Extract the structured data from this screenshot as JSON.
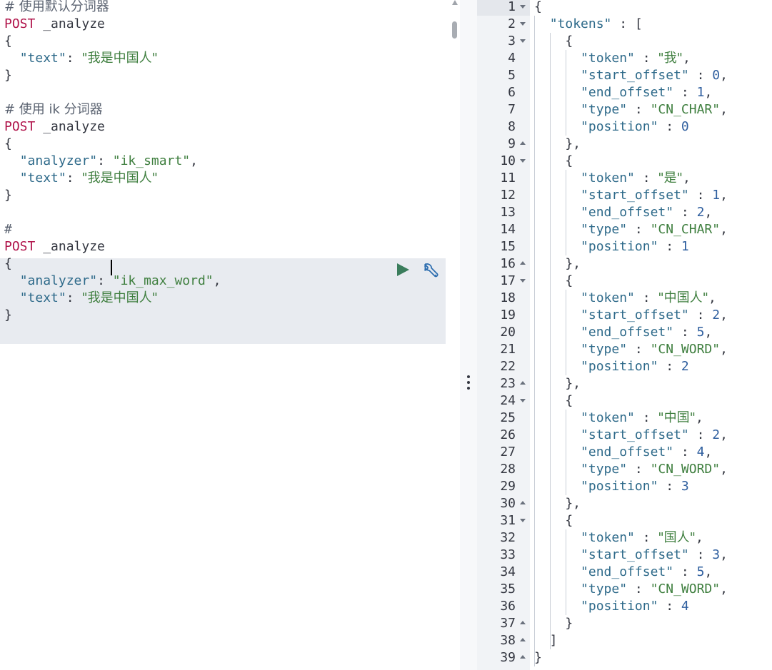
{
  "request_editor": {
    "lines": [
      [
        {
          "t": "comment",
          "v": "# 使用默认分词器"
        }
      ],
      [
        {
          "t": "method",
          "v": "POST"
        },
        {
          "t": "url",
          "v": " _analyze"
        }
      ],
      [
        {
          "t": "brace",
          "v": "{"
        }
      ],
      [
        {
          "t": "punct",
          "v": "  "
        },
        {
          "t": "key",
          "v": "\"text\""
        },
        {
          "t": "punct",
          "v": ": "
        },
        {
          "t": "str",
          "v": "\"我是中国人\""
        }
      ],
      [
        {
          "t": "brace",
          "v": "}"
        }
      ],
      [],
      [
        {
          "t": "comment",
          "v": "# 使用 ik 分词器"
        }
      ],
      [
        {
          "t": "method",
          "v": "POST"
        },
        {
          "t": "url",
          "v": " _analyze"
        }
      ],
      [
        {
          "t": "brace",
          "v": "{"
        }
      ],
      [
        {
          "t": "punct",
          "v": "  "
        },
        {
          "t": "key",
          "v": "\"analyzer\""
        },
        {
          "t": "punct",
          "v": ": "
        },
        {
          "t": "str",
          "v": "\"ik_smart\""
        },
        {
          "t": "punct",
          "v": ","
        }
      ],
      [
        {
          "t": "punct",
          "v": "  "
        },
        {
          "t": "key",
          "v": "\"text\""
        },
        {
          "t": "punct",
          "v": ": "
        },
        {
          "t": "str",
          "v": "\"我是中国人\""
        }
      ],
      [
        {
          "t": "brace",
          "v": "}"
        }
      ],
      [],
      [
        {
          "t": "comment",
          "v": "#"
        }
      ],
      [
        {
          "t": "method",
          "v": "POST"
        },
        {
          "t": "url",
          "v": " _analyze"
        }
      ],
      [
        {
          "t": "brace",
          "v": "{"
        }
      ],
      [
        {
          "t": "punct",
          "v": "  "
        },
        {
          "t": "key",
          "v": "\"analyzer\""
        },
        {
          "t": "punct",
          "v": ": "
        },
        {
          "t": "str",
          "v": "\"ik_max_word\""
        },
        {
          "t": "punct",
          "v": ","
        }
      ],
      [
        {
          "t": "punct",
          "v": "  "
        },
        {
          "t": "key",
          "v": "\"text\""
        },
        {
          "t": "punct",
          "v": ": "
        },
        {
          "t": "str",
          "v": "\"我是中国人\""
        }
      ],
      [
        {
          "t": "brace",
          "v": "}"
        }
      ]
    ],
    "run_icon": "play-icon",
    "settings_icon": "wrench-icon"
  },
  "response_viewer": {
    "lines": [
      {
        "n": "1",
        "fold": "open",
        "p": [
          {
            "t": "brace",
            "v": "{"
          }
        ]
      },
      {
        "n": "2",
        "fold": "open",
        "p": [
          {
            "t": "punct",
            "v": "  "
          },
          {
            "t": "key",
            "v": "\"tokens\""
          },
          {
            "t": "punct",
            "v": " : ["
          }
        ]
      },
      {
        "n": "3",
        "fold": "open",
        "p": [
          {
            "t": "punct",
            "v": "    {"
          }
        ]
      },
      {
        "n": "4",
        "p": [
          {
            "t": "punct",
            "v": "      "
          },
          {
            "t": "key",
            "v": "\"token\""
          },
          {
            "t": "punct",
            "v": " : "
          },
          {
            "t": "str",
            "v": "\"我\""
          },
          {
            "t": "punct",
            "v": ","
          }
        ]
      },
      {
        "n": "5",
        "p": [
          {
            "t": "punct",
            "v": "      "
          },
          {
            "t": "key",
            "v": "\"start_offset\""
          },
          {
            "t": "punct",
            "v": " : "
          },
          {
            "t": "num",
            "v": "0"
          },
          {
            "t": "punct",
            "v": ","
          }
        ]
      },
      {
        "n": "6",
        "p": [
          {
            "t": "punct",
            "v": "      "
          },
          {
            "t": "key",
            "v": "\"end_offset\""
          },
          {
            "t": "punct",
            "v": " : "
          },
          {
            "t": "num",
            "v": "1"
          },
          {
            "t": "punct",
            "v": ","
          }
        ]
      },
      {
        "n": "7",
        "p": [
          {
            "t": "punct",
            "v": "      "
          },
          {
            "t": "key",
            "v": "\"type\""
          },
          {
            "t": "punct",
            "v": " : "
          },
          {
            "t": "str",
            "v": "\"CN_CHAR\""
          },
          {
            "t": "punct",
            "v": ","
          }
        ]
      },
      {
        "n": "8",
        "p": [
          {
            "t": "punct",
            "v": "      "
          },
          {
            "t": "key",
            "v": "\"position\""
          },
          {
            "t": "punct",
            "v": " : "
          },
          {
            "t": "num",
            "v": "0"
          }
        ]
      },
      {
        "n": "9",
        "fold": "closed",
        "p": [
          {
            "t": "punct",
            "v": "    },"
          }
        ]
      },
      {
        "n": "10",
        "fold": "open",
        "p": [
          {
            "t": "punct",
            "v": "    {"
          }
        ]
      },
      {
        "n": "11",
        "p": [
          {
            "t": "punct",
            "v": "      "
          },
          {
            "t": "key",
            "v": "\"token\""
          },
          {
            "t": "punct",
            "v": " : "
          },
          {
            "t": "str",
            "v": "\"是\""
          },
          {
            "t": "punct",
            "v": ","
          }
        ]
      },
      {
        "n": "12",
        "p": [
          {
            "t": "punct",
            "v": "      "
          },
          {
            "t": "key",
            "v": "\"start_offset\""
          },
          {
            "t": "punct",
            "v": " : "
          },
          {
            "t": "num",
            "v": "1"
          },
          {
            "t": "punct",
            "v": ","
          }
        ]
      },
      {
        "n": "13",
        "p": [
          {
            "t": "punct",
            "v": "      "
          },
          {
            "t": "key",
            "v": "\"end_offset\""
          },
          {
            "t": "punct",
            "v": " : "
          },
          {
            "t": "num",
            "v": "2"
          },
          {
            "t": "punct",
            "v": ","
          }
        ]
      },
      {
        "n": "14",
        "p": [
          {
            "t": "punct",
            "v": "      "
          },
          {
            "t": "key",
            "v": "\"type\""
          },
          {
            "t": "punct",
            "v": " : "
          },
          {
            "t": "str",
            "v": "\"CN_CHAR\""
          },
          {
            "t": "punct",
            "v": ","
          }
        ]
      },
      {
        "n": "15",
        "p": [
          {
            "t": "punct",
            "v": "      "
          },
          {
            "t": "key",
            "v": "\"position\""
          },
          {
            "t": "punct",
            "v": " : "
          },
          {
            "t": "num",
            "v": "1"
          }
        ]
      },
      {
        "n": "16",
        "fold": "closed",
        "p": [
          {
            "t": "punct",
            "v": "    },"
          }
        ]
      },
      {
        "n": "17",
        "fold": "open",
        "p": [
          {
            "t": "punct",
            "v": "    {"
          }
        ]
      },
      {
        "n": "18",
        "p": [
          {
            "t": "punct",
            "v": "      "
          },
          {
            "t": "key",
            "v": "\"token\""
          },
          {
            "t": "punct",
            "v": " : "
          },
          {
            "t": "str",
            "v": "\"中国人\""
          },
          {
            "t": "punct",
            "v": ","
          }
        ]
      },
      {
        "n": "19",
        "p": [
          {
            "t": "punct",
            "v": "      "
          },
          {
            "t": "key",
            "v": "\"start_offset\""
          },
          {
            "t": "punct",
            "v": " : "
          },
          {
            "t": "num",
            "v": "2"
          },
          {
            "t": "punct",
            "v": ","
          }
        ]
      },
      {
        "n": "20",
        "p": [
          {
            "t": "punct",
            "v": "      "
          },
          {
            "t": "key",
            "v": "\"end_offset\""
          },
          {
            "t": "punct",
            "v": " : "
          },
          {
            "t": "num",
            "v": "5"
          },
          {
            "t": "punct",
            "v": ","
          }
        ]
      },
      {
        "n": "21",
        "p": [
          {
            "t": "punct",
            "v": "      "
          },
          {
            "t": "key",
            "v": "\"type\""
          },
          {
            "t": "punct",
            "v": " : "
          },
          {
            "t": "str",
            "v": "\"CN_WORD\""
          },
          {
            "t": "punct",
            "v": ","
          }
        ]
      },
      {
        "n": "22",
        "p": [
          {
            "t": "punct",
            "v": "      "
          },
          {
            "t": "key",
            "v": "\"position\""
          },
          {
            "t": "punct",
            "v": " : "
          },
          {
            "t": "num",
            "v": "2"
          }
        ]
      },
      {
        "n": "23",
        "fold": "closed",
        "p": [
          {
            "t": "punct",
            "v": "    },"
          }
        ]
      },
      {
        "n": "24",
        "fold": "open",
        "p": [
          {
            "t": "punct",
            "v": "    {"
          }
        ]
      },
      {
        "n": "25",
        "p": [
          {
            "t": "punct",
            "v": "      "
          },
          {
            "t": "key",
            "v": "\"token\""
          },
          {
            "t": "punct",
            "v": " : "
          },
          {
            "t": "str",
            "v": "\"中国\""
          },
          {
            "t": "punct",
            "v": ","
          }
        ]
      },
      {
        "n": "26",
        "p": [
          {
            "t": "punct",
            "v": "      "
          },
          {
            "t": "key",
            "v": "\"start_offset\""
          },
          {
            "t": "punct",
            "v": " : "
          },
          {
            "t": "num",
            "v": "2"
          },
          {
            "t": "punct",
            "v": ","
          }
        ]
      },
      {
        "n": "27",
        "p": [
          {
            "t": "punct",
            "v": "      "
          },
          {
            "t": "key",
            "v": "\"end_offset\""
          },
          {
            "t": "punct",
            "v": " : "
          },
          {
            "t": "num",
            "v": "4"
          },
          {
            "t": "punct",
            "v": ","
          }
        ]
      },
      {
        "n": "28",
        "p": [
          {
            "t": "punct",
            "v": "      "
          },
          {
            "t": "key",
            "v": "\"type\""
          },
          {
            "t": "punct",
            "v": " : "
          },
          {
            "t": "str",
            "v": "\"CN_WORD\""
          },
          {
            "t": "punct",
            "v": ","
          }
        ]
      },
      {
        "n": "29",
        "p": [
          {
            "t": "punct",
            "v": "      "
          },
          {
            "t": "key",
            "v": "\"position\""
          },
          {
            "t": "punct",
            "v": " : "
          },
          {
            "t": "num",
            "v": "3"
          }
        ]
      },
      {
        "n": "30",
        "fold": "closed",
        "p": [
          {
            "t": "punct",
            "v": "    },"
          }
        ]
      },
      {
        "n": "31",
        "fold": "open",
        "p": [
          {
            "t": "punct",
            "v": "    {"
          }
        ]
      },
      {
        "n": "32",
        "p": [
          {
            "t": "punct",
            "v": "      "
          },
          {
            "t": "key",
            "v": "\"token\""
          },
          {
            "t": "punct",
            "v": " : "
          },
          {
            "t": "str",
            "v": "\"国人\""
          },
          {
            "t": "punct",
            "v": ","
          }
        ]
      },
      {
        "n": "33",
        "p": [
          {
            "t": "punct",
            "v": "      "
          },
          {
            "t": "key",
            "v": "\"start_offset\""
          },
          {
            "t": "punct",
            "v": " : "
          },
          {
            "t": "num",
            "v": "3"
          },
          {
            "t": "punct",
            "v": ","
          }
        ]
      },
      {
        "n": "34",
        "p": [
          {
            "t": "punct",
            "v": "      "
          },
          {
            "t": "key",
            "v": "\"end_offset\""
          },
          {
            "t": "punct",
            "v": " : "
          },
          {
            "t": "num",
            "v": "5"
          },
          {
            "t": "punct",
            "v": ","
          }
        ]
      },
      {
        "n": "35",
        "p": [
          {
            "t": "punct",
            "v": "      "
          },
          {
            "t": "key",
            "v": "\"type\""
          },
          {
            "t": "punct",
            "v": " : "
          },
          {
            "t": "str",
            "v": "\"CN_WORD\""
          },
          {
            "t": "punct",
            "v": ","
          }
        ]
      },
      {
        "n": "36",
        "p": [
          {
            "t": "punct",
            "v": "      "
          },
          {
            "t": "key",
            "v": "\"position\""
          },
          {
            "t": "punct",
            "v": " : "
          },
          {
            "t": "num",
            "v": "4"
          }
        ]
      },
      {
        "n": "37",
        "fold": "closed",
        "p": [
          {
            "t": "punct",
            "v": "    }"
          }
        ]
      },
      {
        "n": "38",
        "fold": "closed",
        "p": [
          {
            "t": "punct",
            "v": "  ]"
          }
        ]
      },
      {
        "n": "39",
        "fold": "closed",
        "p": [
          {
            "t": "brace",
            "v": "}"
          }
        ]
      }
    ]
  },
  "resizer_icon": "vertical-dots-icon"
}
